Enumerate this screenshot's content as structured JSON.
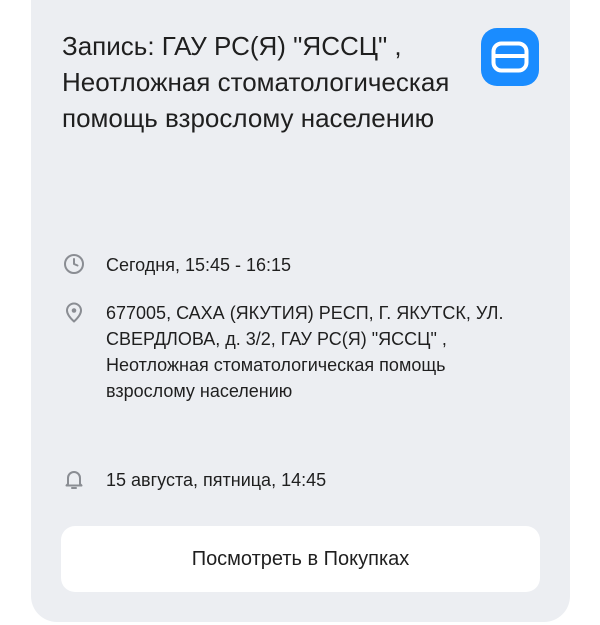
{
  "card": {
    "title": "Запись: ГАУ РС(Я) \"ЯССЦ\" , Неотложная стоматологическая помощь взрослому населению",
    "app_icon": "wallet-card-icon",
    "time": {
      "icon": "clock-icon",
      "text": "Сегодня, 15:45 - 16:15"
    },
    "address": {
      "icon": "location-pin-icon",
      "text": "677005, САХА (ЯКУТИЯ) РЕСП, Г. ЯКУТСК, УЛ. СВЕРДЛОВА, д. 3/2, ГАУ РС(Я) \"ЯССЦ\" , Неотложная стоматологическая помощь взрослому населению"
    },
    "reminder": {
      "icon": "bell-icon",
      "text": "15 августа, пятница, 14:45"
    },
    "button_label": "Посмотреть в Покупках"
  },
  "colors": {
    "card_background": "#eceef2",
    "accent": "#1a8cff",
    "icon_gray": "#8a8d93",
    "text": "#1f1f1f"
  }
}
